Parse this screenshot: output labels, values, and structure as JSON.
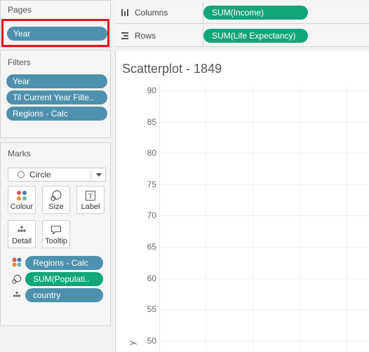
{
  "pages": {
    "title": "Pages",
    "pill": "Year"
  },
  "filters": {
    "title": "Filters",
    "items": [
      "Year",
      "Til Current Year Filte..",
      "Regions - Calc"
    ]
  },
  "marks": {
    "title": "Marks",
    "type": "Circle",
    "buttons": {
      "colour": "Colour",
      "size": "Size",
      "label": "Label",
      "detail": "Detail",
      "tooltip": "Tooltip"
    },
    "fields": [
      {
        "name": "Regions - Calc",
        "icon": "colour-icon"
      },
      {
        "name": "SUM(Populati..",
        "icon": "size-icon"
      },
      {
        "name": "country",
        "icon": "detail-icon"
      }
    ]
  },
  "shelves": {
    "columns_label": "Columns",
    "columns_pill": "SUM(Income)",
    "rows_label": "Rows",
    "rows_pill": "SUM(Life Expectancy)"
  },
  "sheet": {
    "title": "Scatterplot - 1849",
    "y_ticks": [
      "90",
      "85",
      "80",
      "75",
      "70",
      "65",
      "60",
      "55",
      "50"
    ],
    "y_axis_label_fragment": "y"
  },
  "colors": {
    "blue_pill": "#4e91ad",
    "green_pill": "#13a57a",
    "highlight": "#e0141e"
  }
}
